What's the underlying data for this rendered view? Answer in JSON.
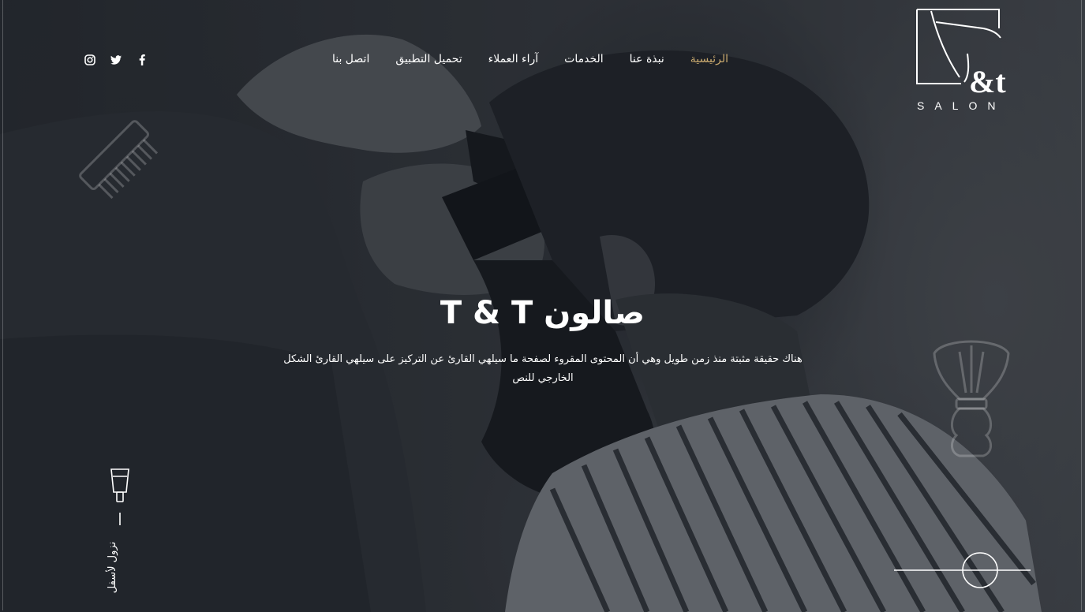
{
  "brand": {
    "logo_mark": "&t",
    "logo_word": "SALON"
  },
  "nav": {
    "items": [
      {
        "label": "الرئيسية",
        "active": true
      },
      {
        "label": "نبذة عنا",
        "active": false
      },
      {
        "label": "الخدمات",
        "active": false
      },
      {
        "label": "آراء العملاء",
        "active": false
      },
      {
        "label": "تحميل التطبيق",
        "active": false
      },
      {
        "label": "اتصل بنا",
        "active": false
      }
    ],
    "active_color": "#c9a96e"
  },
  "social": {
    "icons": [
      "facebook-icon",
      "twitter-icon",
      "instagram-icon"
    ]
  },
  "hero": {
    "title": "صالون T & T",
    "subtitle": "هناك حقيقة مثبتة منذ زمن طويل وهي أن المحتوى المقروء لصفحة ما سيلهي القارئ عن التركيز على سيلهي القارئ الشكل الخارجي للنص",
    "scroll_label": "نزول لأسفل"
  }
}
